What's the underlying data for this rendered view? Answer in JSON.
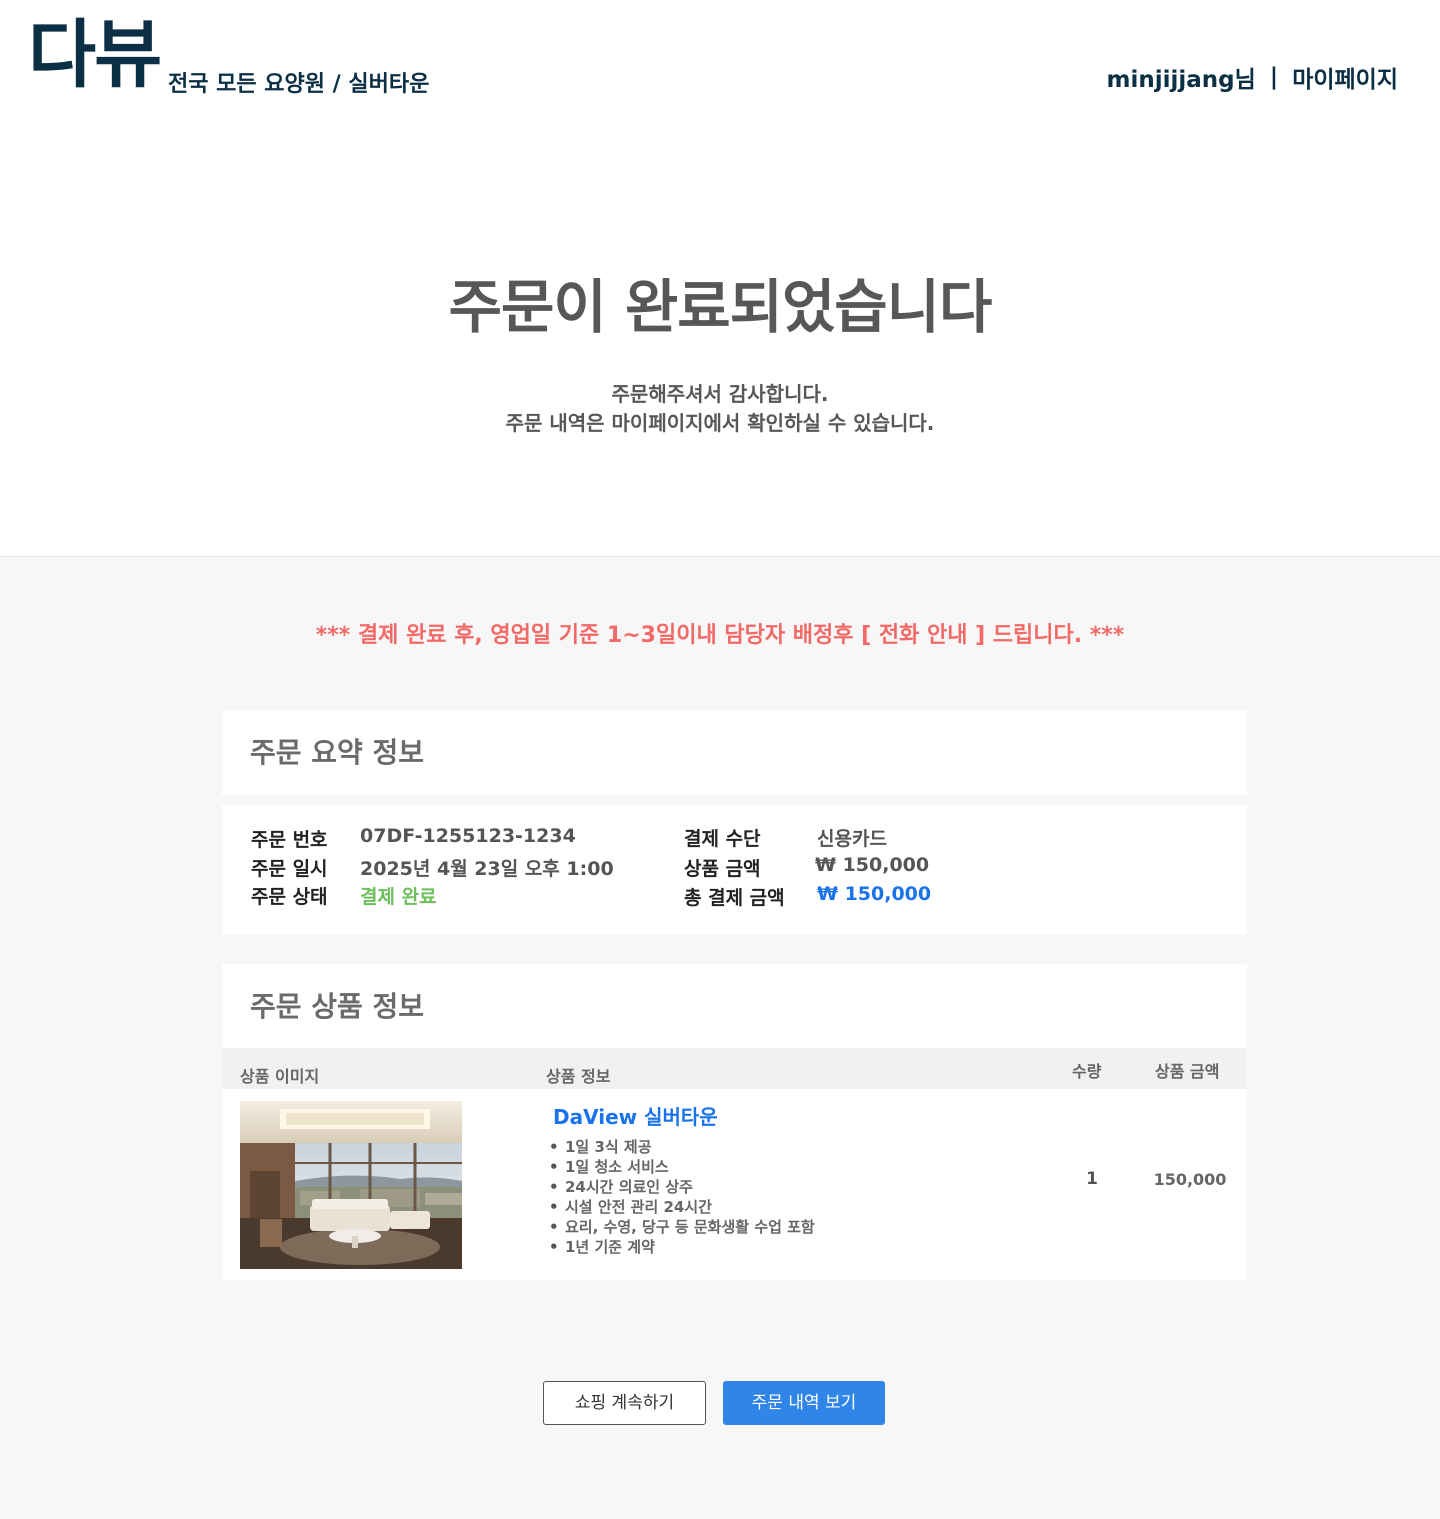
{
  "header": {
    "logo": "다뷰",
    "tagline": "전국 모든 요양원 / 실버타운",
    "username": "minjijjang님",
    "separator": "|",
    "mypage_link": "마이페이지"
  },
  "hero": {
    "title": "주문이 완료되었습니다",
    "message_line1": "주문해주셔서 감사합니다.",
    "message_line2": "주문 내역은 마이페이지에서 확인하실 수 있습니다."
  },
  "notice": "*** 결제 완료 후, 영업일 기준 1~3일이내 담당자 배정후 [ 전화 안내 ] 드립니다. ***",
  "summary": {
    "title": "주문 요약 정보",
    "order_number_label": "주문 번호",
    "order_number": "07DF-1255123-1234",
    "order_date_label": "주문 일시",
    "order_date": "2025년 4월 23일 오후 1:00",
    "order_status_label": "주문 상태",
    "order_status": "결제 완료",
    "payment_method_label": "결제 수단",
    "payment_method": "신용카드",
    "product_amount_label": "상품 금액",
    "product_amount": "₩ 150,000",
    "total_amount_label": "총 결제 금액",
    "total_amount": "₩ 150,000"
  },
  "items": {
    "title": "주문 상품 정보",
    "columns": {
      "image": "상품 이미지",
      "info": "상품 정보",
      "quantity": "수량",
      "price": "상품 금액"
    },
    "rows": [
      {
        "name": "DaView 실버타운",
        "features": [
          "1일 3식 제공",
          "1일 청소 서비스",
          "24시간 의료인 상주",
          "시설 안전 관리 24시간",
          "요리, 수영, 당구 등 문화생활 수업 포함",
          "1년 기준 계약"
        ],
        "quantity": "1",
        "price": "150,000"
      }
    ]
  },
  "buttons": {
    "continue_shopping": "쇼핑 계속하기",
    "view_orders": "주문 내역 보기"
  },
  "colors": {
    "brand_navy": "#0b2f45",
    "notice_red": "#f26a67",
    "status_green": "#6cbf5b",
    "accent_blue": "#1a73e8",
    "primary_button": "#2f86e8"
  }
}
